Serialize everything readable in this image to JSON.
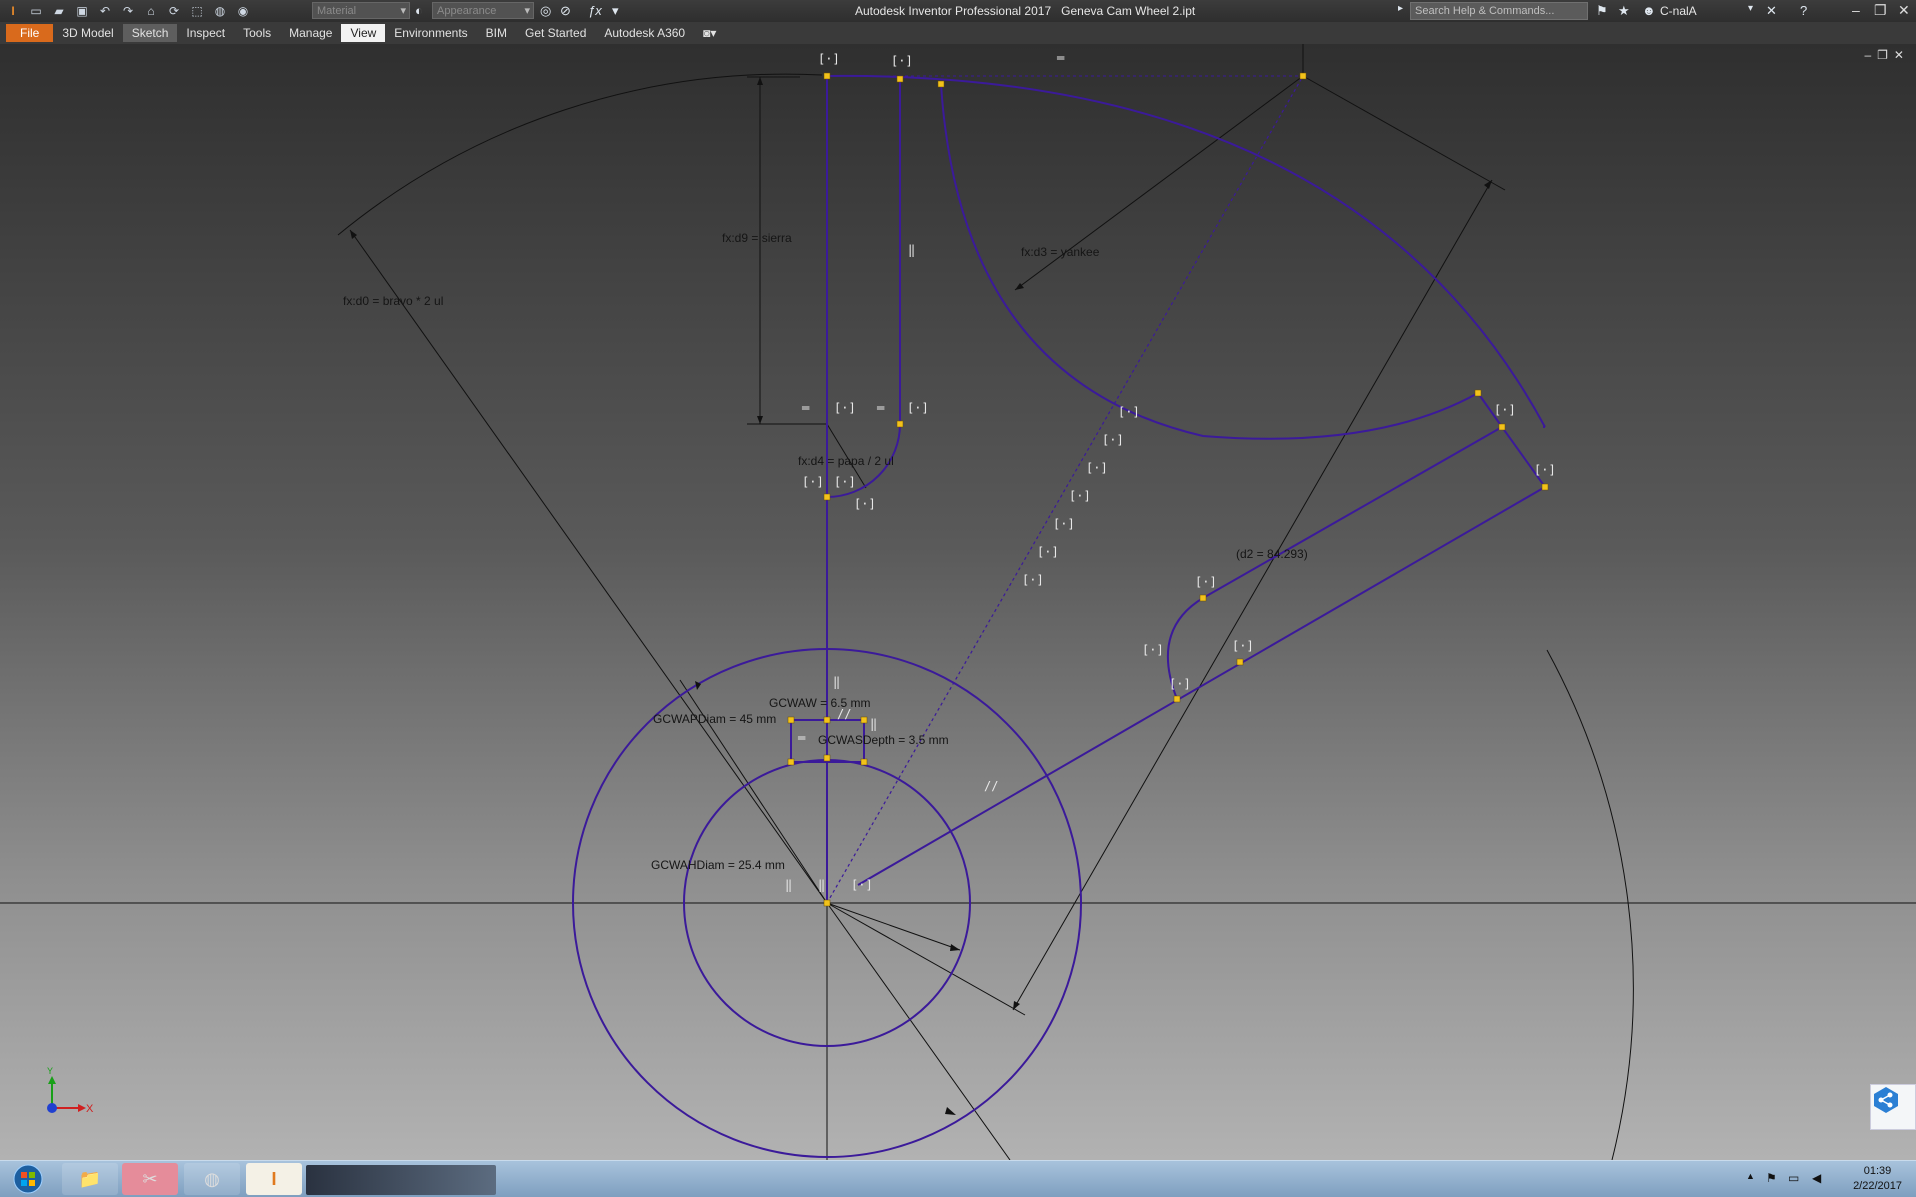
{
  "app": {
    "title": "Autodesk Inventor Professional 2017",
    "document": "Geneva Cam Wheel 2.ipt",
    "search_placeholder": "Search Help & Commands...",
    "user": "C-nalA",
    "material_placeholder": "Material",
    "appearance_placeholder": "Appearance"
  },
  "menu": [
    {
      "label": "File",
      "kind": "file"
    },
    {
      "label": "3D Model",
      "kind": ""
    },
    {
      "label": "Sketch",
      "kind": "sketch"
    },
    {
      "label": "Inspect",
      "kind": ""
    },
    {
      "label": "Tools",
      "kind": ""
    },
    {
      "label": "Manage",
      "kind": ""
    },
    {
      "label": "View",
      "kind": "active"
    },
    {
      "label": "Environments",
      "kind": ""
    },
    {
      "label": "BIM",
      "kind": ""
    },
    {
      "label": "Get Started",
      "kind": ""
    },
    {
      "label": "Autodesk A360",
      "kind": ""
    }
  ],
  "dimensions": {
    "d9": "fx:d9 = sierra",
    "d0": "fx:d0 = bravo * 2 ul",
    "d3": "fx:d3 = yankee",
    "d4": "fx:d4 = papa / 2 ul",
    "d2": "(d2 = 84.293)",
    "gcwaw": "GCWAW = 6.5 mm",
    "gcwap": "GCWAPDiam = 45 mm",
    "gcwas": "GCWASDepth = 3.5 mm",
    "gcwah": "GCWAHDiam = 25.4 mm"
  },
  "constraint_glyphs": {
    "coincident": "[·]",
    "horizontal": "═",
    "vertical": "‖",
    "parallel": "//"
  },
  "axis": {
    "x_label": "X",
    "y_label": "Y"
  },
  "taskbar": {
    "time": "01:39",
    "date": "2/22/2017"
  },
  "colors": {
    "sketch_line": "#3b1a9a",
    "constraint_point": "#f2c21b",
    "file_tab": "#d96a1c",
    "axis_x": "#d02020",
    "axis_y": "#18a018",
    "axis_z": "#2040d0"
  },
  "icons": [
    "new-icon",
    "open-icon",
    "save-icon",
    "undo-icon",
    "redo-icon",
    "home-icon",
    "search-icon",
    "star-icon",
    "user-icon",
    "help-icon",
    "share-icon",
    "windows-start-icon",
    "explorer-icon",
    "firefox-icon",
    "inventor-icon"
  ]
}
